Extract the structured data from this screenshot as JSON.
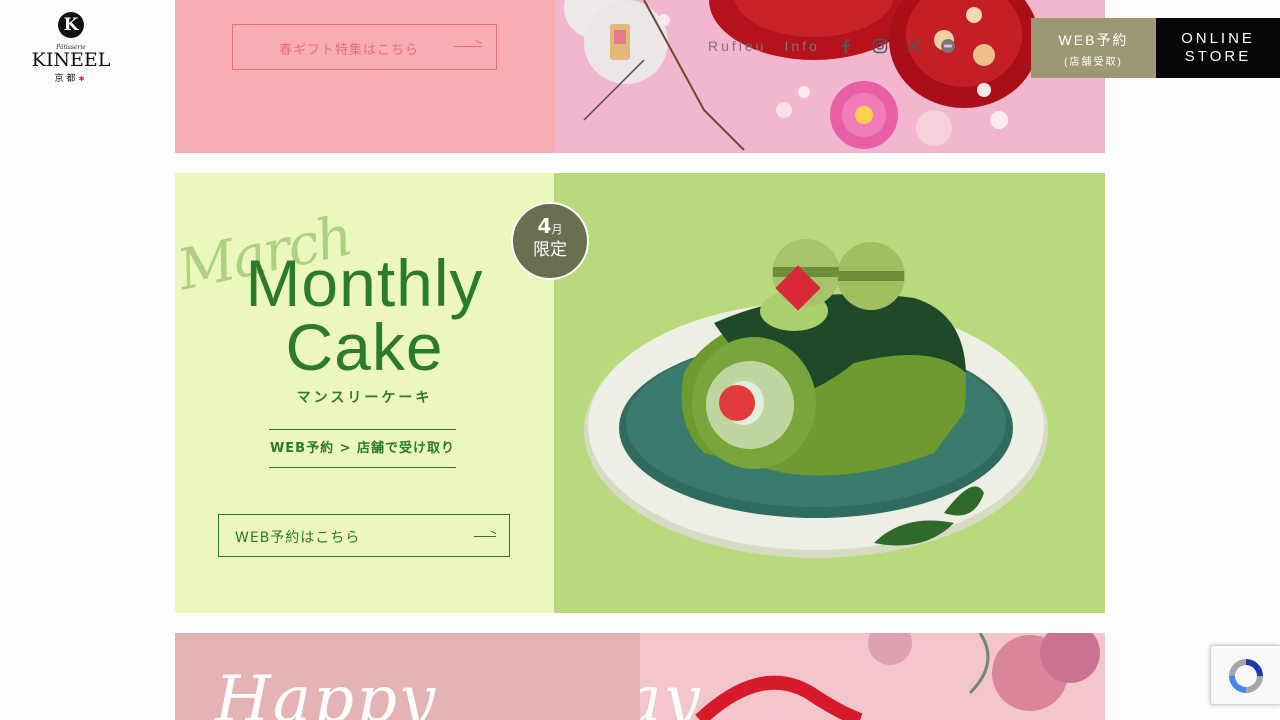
{
  "logo": {
    "sub": "Pâtisserie",
    "name": "KINEEL",
    "kyoto": "京都"
  },
  "header": {
    "nav": [
      {
        "label": "Rufleu"
      },
      {
        "label": "Info"
      }
    ],
    "icons": [
      "facebook-icon",
      "instagram-icon",
      "x-icon",
      "line-icon"
    ],
    "web_reserve": {
      "main": "WEB予約",
      "sub": "(店舗受取)"
    },
    "online_store": {
      "line1": "ONLINE",
      "line2": "STORE"
    }
  },
  "spring": {
    "button_label": "春ギフト特集はこちら"
  },
  "monthly": {
    "script": "March",
    "title_line1": "Monthly",
    "title_line2": "Cake",
    "subtitle": "マンスリーケーキ",
    "badge_web": "WEB予約",
    "badge_pickup": "店舗で受け取り",
    "button_label": "WEB予約はこちら",
    "april_num": "4",
    "april_unit": "月",
    "april_limited": "限定"
  },
  "mothers": {
    "script_left": "Happy",
    "script_right": "Day"
  },
  "colors": {
    "spring_pink": "#f7aeb2",
    "spring_accent": "#ef6b7a",
    "monthly_bg": "#ebf7bd",
    "monthly_green": "#2b7a2e",
    "web_button": "#9c9873",
    "online_button": "#070707"
  }
}
